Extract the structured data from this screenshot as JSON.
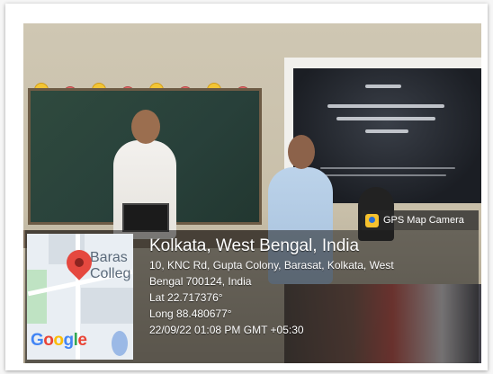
{
  "gps_stamp": {
    "badge_label": "GPS Map Camera",
    "location_title": "Kolkata, West Bengal, India",
    "address_line_1": "10, KNC Rd, Gupta Colony, Barasat, Kolkata, West",
    "address_line_2": "Bengal 700124, India",
    "latitude": "Lat 22.717376°",
    "longitude": "Long 88.480677°",
    "datetime": "22/09/22 01:08 PM GMT +05:30"
  },
  "map_thumbnail": {
    "place_label_1": "Baras",
    "place_label_2": "Colleg",
    "logo": [
      "G",
      "o",
      "o",
      "g",
      "l",
      "e"
    ]
  },
  "icons": [
    "camera-icon",
    "map-pin-icon"
  ]
}
